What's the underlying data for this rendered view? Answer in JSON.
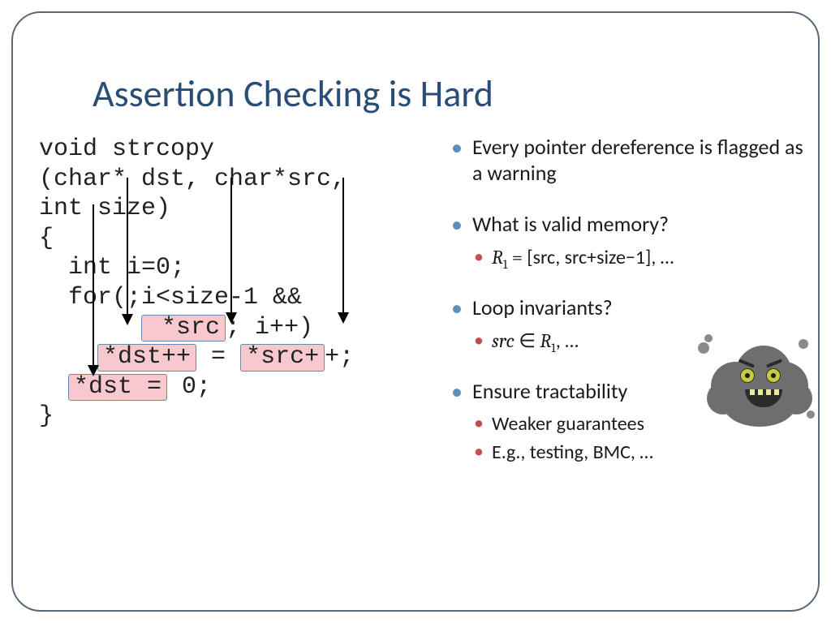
{
  "title": "Assertion Checking is Hard",
  "code": {
    "l1": "void strcopy",
    "l2": "(char* dst, char*src,",
    "l3": "int size)",
    "l4": "{",
    "l5": "  int i=0;",
    "l6a": "  for(;i<size-1 &&",
    "l6b_pre": "       ",
    "l6b_hl": " *src",
    "l6b_post": "; i++)",
    "l7_pre": "    ",
    "l7_hl1": "*dst++",
    "l7_mid": " = ",
    "l7_hl2": "*src+",
    "l7_post": "+;",
    "l8_pre": "  ",
    "l8_hl": "*dst =",
    "l8_post": " 0;",
    "l9": "}"
  },
  "bullets": {
    "b1": "Every pointer dereference is flagged as a warning",
    "b2": "What is valid memory?",
    "b2a_pre": "R",
    "b2a_sub": "1",
    "b2a_mid": " = ",
    "b2a_post": "[src, src+size−1], …",
    "b3": "Loop invariants?",
    "b3a_src": "src",
    "b3a_in": " ∈ ",
    "b3a_R": "R",
    "b3a_sub": "1",
    "b3a_post": ", …",
    "b4": "Ensure tractability",
    "b4a": "Weaker guarantees",
    "b4b": "E.g., testing, BMC, …"
  }
}
